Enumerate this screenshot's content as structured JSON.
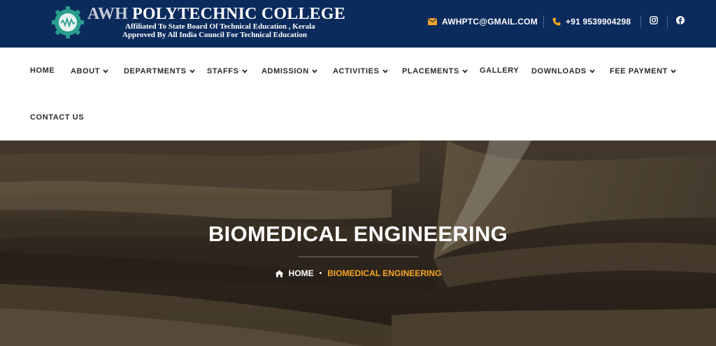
{
  "header": {
    "brand_prefix": "AWH",
    "brand_name": "POLYTECHNIC COLLEGE",
    "affiliation": "Affiliated To State Board Of Technical Education , Kerala",
    "approval": "Approved By All India Council For Technical Education",
    "email": "AWHPTC@GMAIL.COM",
    "phone": "+91 9539904298",
    "social": [
      "instagram-icon",
      "facebook-icon"
    ]
  },
  "nav": {
    "items": [
      {
        "label": "HOME",
        "dropdown": false
      },
      {
        "label": "ABOUT",
        "dropdown": true
      },
      {
        "label": "DEPARTMENTS",
        "dropdown": true
      },
      {
        "label": "STAFFS",
        "dropdown": true
      },
      {
        "label": "ADMISSION",
        "dropdown": true
      },
      {
        "label": "ACTIVITIES",
        "dropdown": true
      },
      {
        "label": "PLACEMENTS",
        "dropdown": true
      },
      {
        "label": "GALLERY",
        "dropdown": false
      },
      {
        "label": "DOWNLOADS",
        "dropdown": true
      },
      {
        "label": "FEE PAYMENT",
        "dropdown": true
      },
      {
        "label": "CONTACT US",
        "dropdown": false
      }
    ]
  },
  "hero": {
    "title": "BIOMEDICAL ENGINEERING",
    "breadcrumb": {
      "home": "HOME",
      "separator": "•",
      "current": "BIOMEDICAL ENGINEERING"
    }
  },
  "colors": {
    "topbar": "#0b2b5c",
    "accent": "#f5a623",
    "nav_text": "#2b2b2b"
  }
}
